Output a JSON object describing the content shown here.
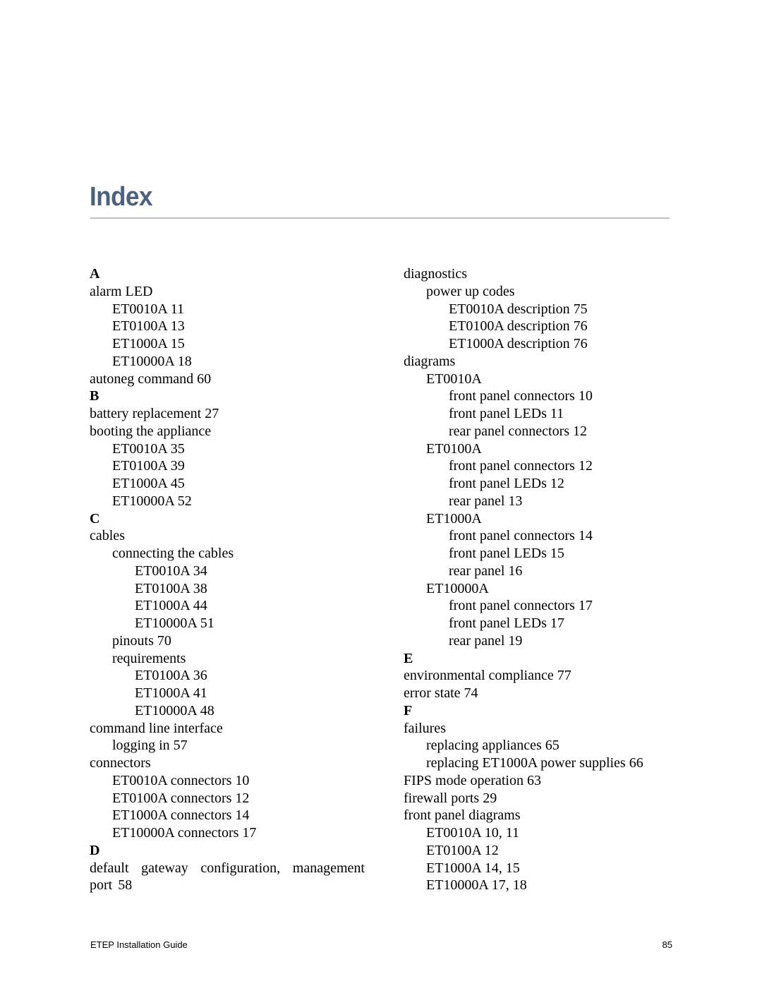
{
  "page": {
    "title": "Index",
    "colors": {
      "title": "#4a6180",
      "rule": "#c0c0c0",
      "text": "#000000"
    }
  },
  "index": {
    "left_column": [
      {
        "text": "A",
        "level": 0,
        "type": "letter"
      },
      {
        "text": "alarm LED",
        "level": 0
      },
      {
        "text": "ET0010A 11",
        "level": 1
      },
      {
        "text": "ET0100A 13",
        "level": 1
      },
      {
        "text": "ET1000A 15",
        "level": 1
      },
      {
        "text": "ET10000A 18",
        "level": 1
      },
      {
        "text": "autoneg command 60",
        "level": 0
      },
      {
        "text": "B",
        "level": 0,
        "type": "letter"
      },
      {
        "text": "battery replacement 27",
        "level": 0
      },
      {
        "text": "booting the appliance",
        "level": 0
      },
      {
        "text": "ET0010A 35",
        "level": 1
      },
      {
        "text": "ET0100A 39",
        "level": 1
      },
      {
        "text": "ET1000A 45",
        "level": 1
      },
      {
        "text": "ET10000A 52",
        "level": 1
      },
      {
        "text": "C",
        "level": 0,
        "type": "letter"
      },
      {
        "text": "cables",
        "level": 0
      },
      {
        "text": "connecting the cables",
        "level": 1
      },
      {
        "text": "ET0010A 34",
        "level": 2
      },
      {
        "text": "ET0100A 38",
        "level": 2
      },
      {
        "text": "ET1000A 44",
        "level": 2
      },
      {
        "text": "ET10000A 51",
        "level": 2
      },
      {
        "text": "pinouts 70",
        "level": 1
      },
      {
        "text": "requirements",
        "level": 1
      },
      {
        "text": "ET0100A 36",
        "level": 2
      },
      {
        "text": "ET1000A 41",
        "level": 2
      },
      {
        "text": "ET10000A 48",
        "level": 2
      },
      {
        "text": "command line interface",
        "level": 0
      },
      {
        "text": "logging in 57",
        "level": 1
      },
      {
        "text": "connectors",
        "level": 0
      },
      {
        "text": "ET0010A connectors 10",
        "level": 1
      },
      {
        "text": "ET0100A connectors 12",
        "level": 1
      },
      {
        "text": "ET1000A connectors 14",
        "level": 1
      },
      {
        "text": "ET10000A connectors 17",
        "level": 1
      },
      {
        "text": "D",
        "level": 0,
        "type": "letter"
      },
      {
        "text": "default gateway configuration, management port 58",
        "level": 0,
        "type": "wrap"
      }
    ],
    "right_column": [
      {
        "text": "diagnostics",
        "level": 0
      },
      {
        "text": "power up codes",
        "level": 1
      },
      {
        "text": "ET0010A description 75",
        "level": 2
      },
      {
        "text": "ET0100A description 76",
        "level": 2
      },
      {
        "text": "ET1000A description 76",
        "level": 2
      },
      {
        "text": "diagrams",
        "level": 0
      },
      {
        "text": "ET0010A",
        "level": 1
      },
      {
        "text": "front panel connectors 10",
        "level": 2
      },
      {
        "text": "front panel LEDs 11",
        "level": 2
      },
      {
        "text": "rear panel connectors 12",
        "level": 2
      },
      {
        "text": "ET0100A",
        "level": 1
      },
      {
        "text": "front panel connectors 12",
        "level": 2
      },
      {
        "text": "front panel LEDs 12",
        "level": 2
      },
      {
        "text": "rear panel 13",
        "level": 2
      },
      {
        "text": "ET1000A",
        "level": 1
      },
      {
        "text": "front panel connectors 14",
        "level": 2
      },
      {
        "text": "front panel LEDs 15",
        "level": 2
      },
      {
        "text": "rear panel 16",
        "level": 2
      },
      {
        "text": "ET10000A",
        "level": 1
      },
      {
        "text": "front panel connectors 17",
        "level": 2
      },
      {
        "text": "front panel LEDs 17",
        "level": 2
      },
      {
        "text": "rear panel 19",
        "level": 2
      },
      {
        "text": "E",
        "level": 0,
        "type": "letter"
      },
      {
        "text": "environmental compliance 77",
        "level": 0
      },
      {
        "text": "error state 74",
        "level": 0
      },
      {
        "text": "F",
        "level": 0,
        "type": "letter"
      },
      {
        "text": "failures",
        "level": 0
      },
      {
        "text": "replacing appliances 65",
        "level": 1
      },
      {
        "text": "replacing ET1000A power supplies 66",
        "level": 1
      },
      {
        "text": "FIPS mode operation 63",
        "level": 0
      },
      {
        "text": "firewall ports 29",
        "level": 0
      },
      {
        "text": "front panel diagrams",
        "level": 0
      },
      {
        "text": "ET0010A 10, 11",
        "level": 1
      },
      {
        "text": "ET0100A 12",
        "level": 1
      },
      {
        "text": "ET1000A 14, 15",
        "level": 1
      },
      {
        "text": "ET10000A 17, 18",
        "level": 1
      }
    ]
  },
  "footer": {
    "document_title": "ETEP Installation Guide",
    "page_number": "85"
  }
}
